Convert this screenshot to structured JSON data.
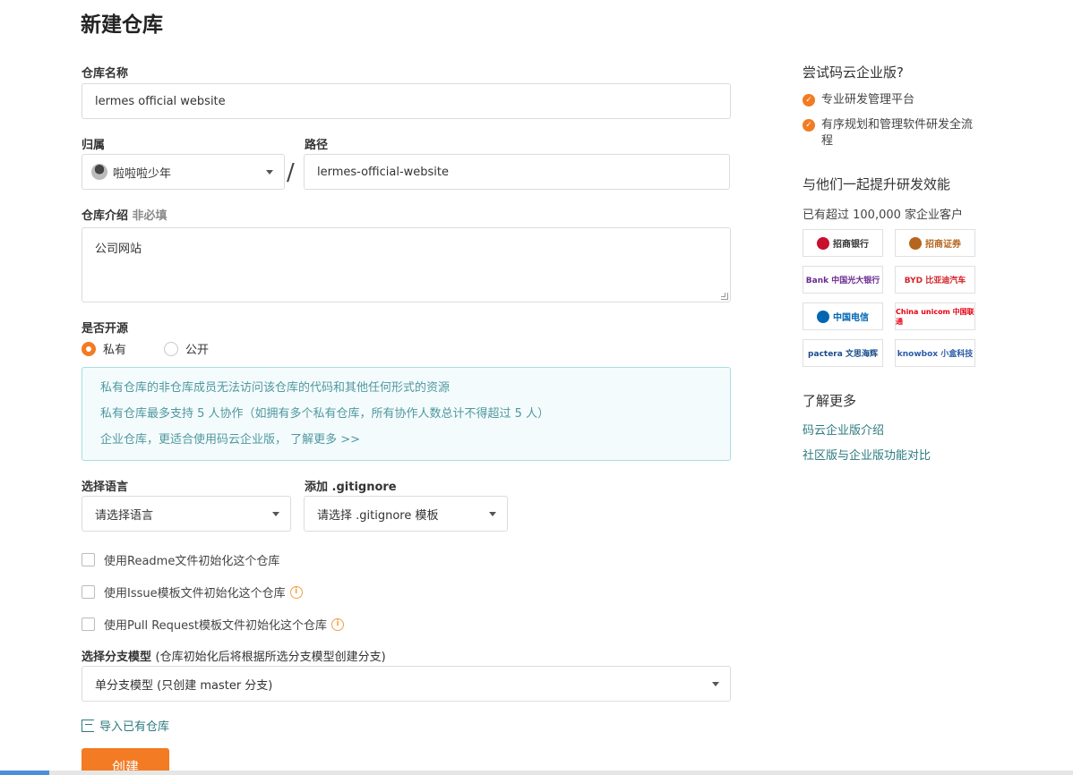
{
  "page": {
    "title": "新建仓库"
  },
  "form": {
    "name": {
      "label": "仓库名称",
      "value": "lermes official website"
    },
    "owner": {
      "label": "归属",
      "value": "啦啦啦少年"
    },
    "path": {
      "label": "路径",
      "value": "lermes-official-website",
      "separator": "/"
    },
    "description": {
      "label": "仓库介绍",
      "optional": "非必填",
      "value": "公司网站"
    },
    "visibility": {
      "label": "是否开源",
      "options": [
        {
          "label": "私有",
          "checked": true
        },
        {
          "label": "公开",
          "checked": false
        }
      ]
    },
    "notice": {
      "lines": [
        "私有仓库的非仓库成员无法访问该仓库的代码和其他任何形式的资源",
        "私有仓库最多支持 5 人协作（如拥有多个私有仓库，所有协作人数总计不得超过 5 人）",
        "企业仓库，更适合使用码云企业版，  了解更多 >>"
      ]
    },
    "language": {
      "label": "选择语言",
      "value": "请选择语言"
    },
    "gitignore": {
      "label": "添加 .gitignore",
      "value": "请选择 .gitignore 模板"
    },
    "checkboxes": [
      {
        "label": "使用Readme文件初始化这个仓库",
        "info": false
      },
      {
        "label": "使用Issue模板文件初始化这个仓库",
        "info": true
      },
      {
        "label": "使用Pull Request模板文件初始化这个仓库",
        "info": true
      }
    ],
    "branch_model": {
      "label": "选择分支模型",
      "hint": "(仓库初始化后将根据所选分支模型创建分支)",
      "value": "单分支模型 (只创建 master 分支)"
    },
    "import_link": "导入已有仓库",
    "submit": "创建"
  },
  "sidebar": {
    "enterprise_title": "尝试码云企业版?",
    "features": [
      "专业研发管理平台",
      "有序规划和管理软件研发全流程"
    ],
    "together_title": "与他们一起提升研发效能",
    "customers_text": "已有超过 100,000 家企业客户",
    "logos": [
      {
        "name": "招商银行",
        "color": "#c8102e"
      },
      {
        "name": "招商证券",
        "color": "#b5651d"
      },
      {
        "name": "Bank 中国光大银行",
        "color": "#6a2c91"
      },
      {
        "name": "BYD 比亚迪汽车",
        "color": "#d2232a"
      },
      {
        "name": "中国电信",
        "color": "#0066b3"
      },
      {
        "name": "China unicom 中国联通",
        "color": "#e60012"
      },
      {
        "name": "pactera 文思海辉",
        "color": "#1a4b8c"
      },
      {
        "name": "knowbox 小盒科技",
        "color": "#2a5aa8"
      }
    ],
    "learn_more_title": "了解更多",
    "links": [
      "码云企业版介绍",
      "社区版与企业版功能对比"
    ]
  },
  "colors": {
    "accent": "#f27b23",
    "link": "#2c7a7f",
    "notice_text": "#4f98a0",
    "notice_border": "#a8dde2"
  },
  "icons": [
    "avatar",
    "chevron-down-icon",
    "radio-icon",
    "checkbox-icon",
    "info-icon",
    "import-icon",
    "check-circle-icon"
  ]
}
